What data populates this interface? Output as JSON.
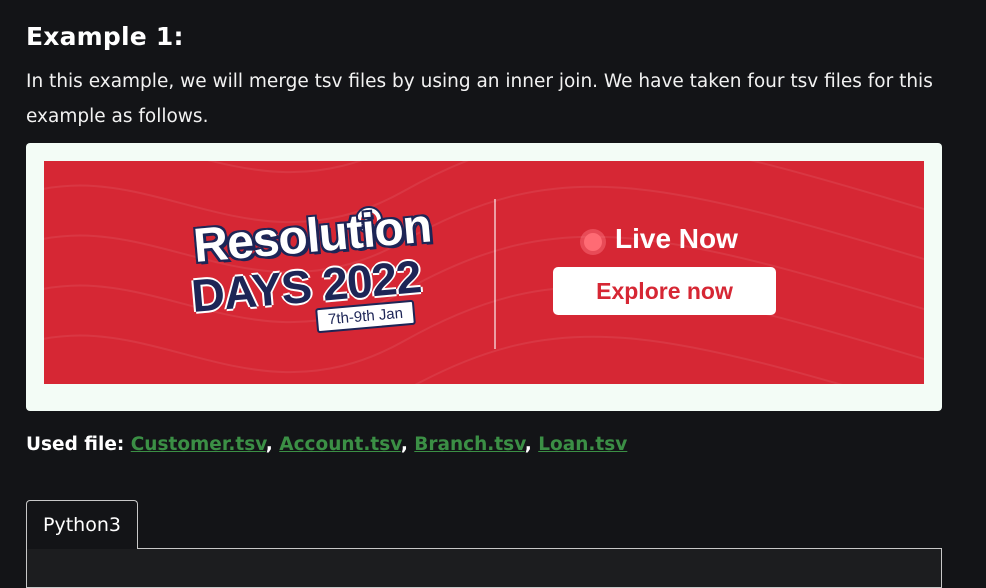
{
  "article": {
    "heading": "Example 1:",
    "paragraph": "In this example, we will merge tsv files by using an inner join. We have taken four tsv files for this example as follows."
  },
  "banner": {
    "logo_line1": "Resolution",
    "logo_line2": "DAYS 2022",
    "date_text": "7th-9th Jan",
    "live_text": "Live Now",
    "cta_label": "Explore now",
    "background_color": "#d62734",
    "frame_color": "#f3fcf6"
  },
  "used_files": {
    "label": "Used file:",
    "links": [
      "Customer.tsv",
      "Account.tsv",
      "Branch.tsv",
      "Loan.tsv"
    ],
    "link_color": "#3b8f45"
  },
  "code_tabs": {
    "active_tab": "Python3"
  }
}
